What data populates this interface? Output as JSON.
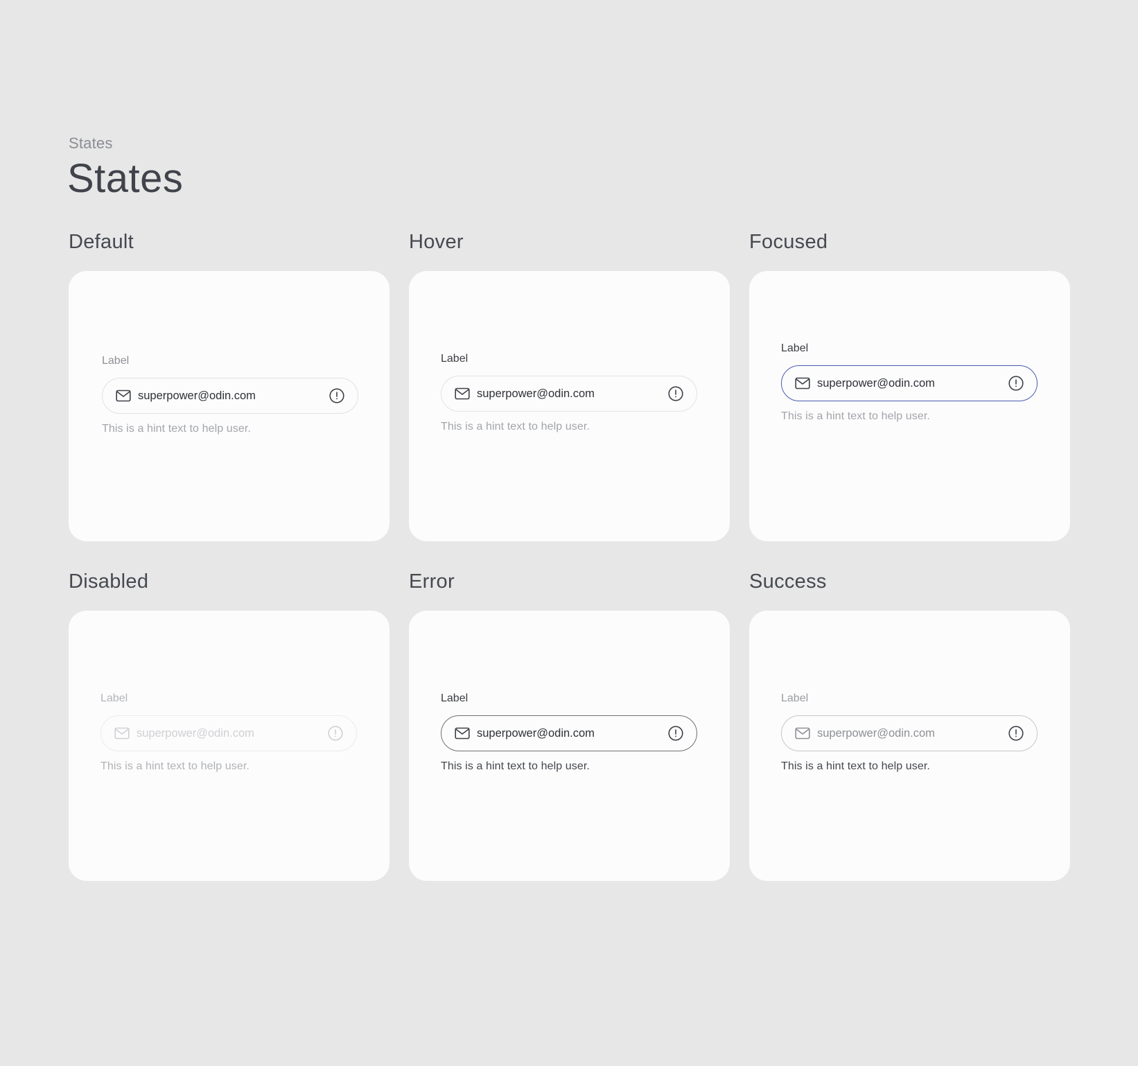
{
  "header": {
    "eyebrow": "States",
    "title": "States"
  },
  "states": [
    {
      "title": "Default",
      "label": "Label",
      "value": "superpower@odin.com",
      "hint": "This is a hint text to help user.",
      "border_color": "#e1e1e4",
      "icon_color": "#3d4047"
    },
    {
      "title": "Hover",
      "label": "Label",
      "value": "superpower@odin.com",
      "hint": "This is a hint text to help user.",
      "border_color": "#e3e3e6",
      "icon_color": "#3d4047"
    },
    {
      "title": "Focused",
      "label": "Label",
      "value": "superpower@odin.com",
      "hint": "This is a hint text to help user.",
      "border_color": "#4a5bb1",
      "icon_color": "#3d4047"
    },
    {
      "title": "Disabled",
      "label": "Label",
      "value": "superpower@odin.com",
      "hint": "This is a hint text to help user.",
      "border_color": "#ececee",
      "icon_color": "#cfd0d3"
    },
    {
      "title": "Error",
      "label": "Label",
      "value": "superpower@odin.com",
      "hint": "This is a hint text to help user.",
      "border_color": "#6e7076",
      "icon_color": "#3d4047"
    },
    {
      "title": "Success",
      "label": "Label",
      "value": "superpower@odin.com",
      "hint": "This is a hint text to help user.",
      "border_color": "#c6c7cb",
      "icon_color": "#8e9095"
    }
  ],
  "icons": {
    "mail": "mail-icon",
    "info": "info-circle-icon"
  }
}
